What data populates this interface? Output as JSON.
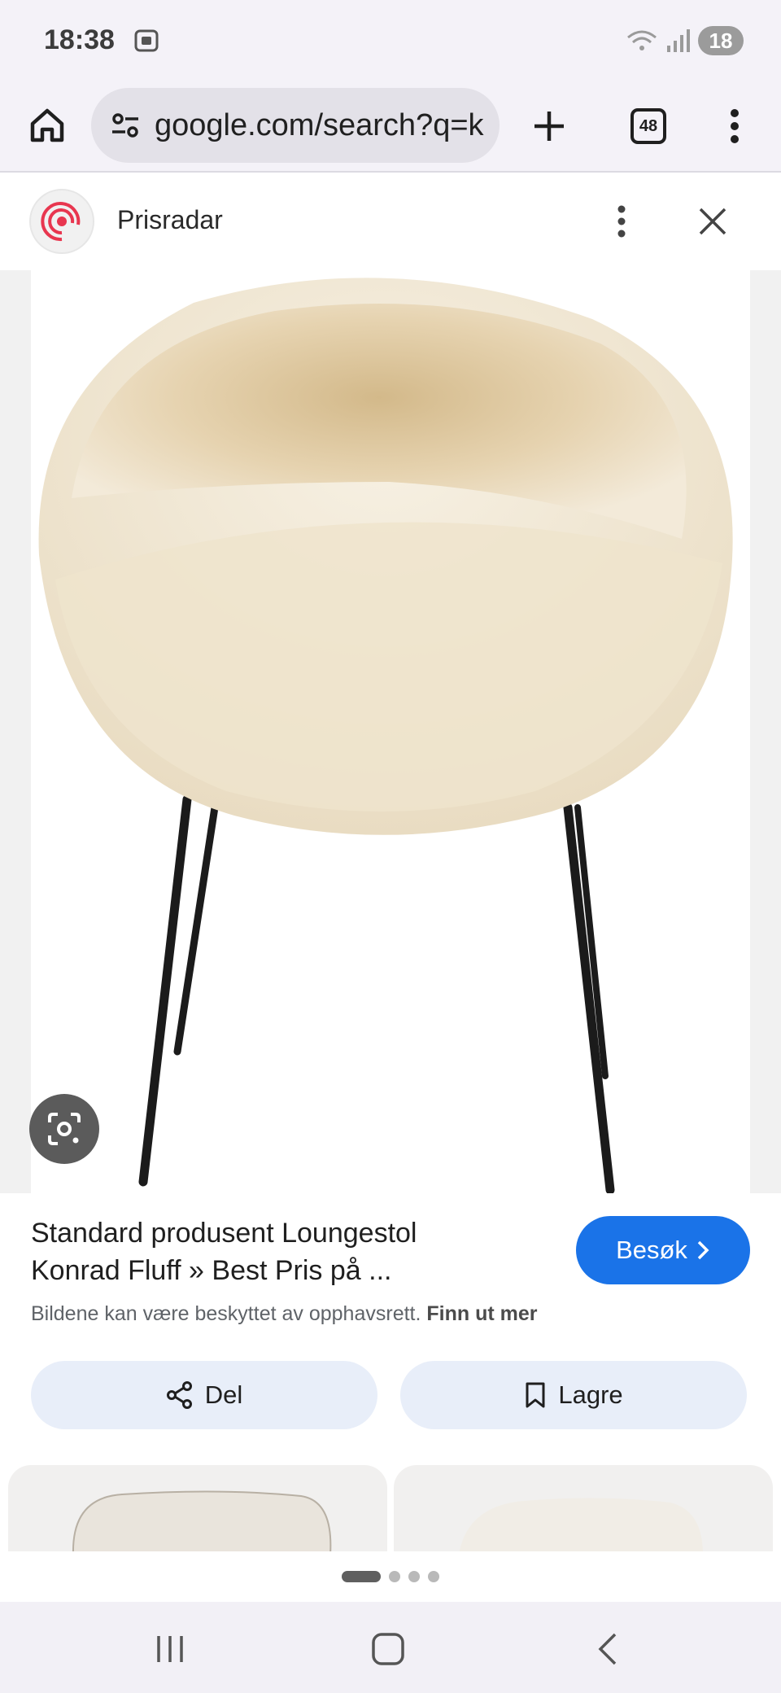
{
  "status_bar": {
    "time": "18:38",
    "battery": "18",
    "icons": [
      "screenshot-icon",
      "wifi-icon",
      "signal-icon",
      "battery-icon"
    ]
  },
  "browser": {
    "url": "google.com/search?q=k",
    "tab_count": "48",
    "icons": [
      "home-icon",
      "site-settings-icon",
      "plus-icon",
      "more-vert-icon"
    ]
  },
  "panel": {
    "app_name": "Prisradar",
    "icons": [
      "prisradar-logo",
      "more-vert-icon",
      "close-icon"
    ]
  },
  "result": {
    "title_line1": "Standard produsent Loungestol",
    "title_line2": "Konrad Fluff » Best Pris på ...",
    "visit_label": "Besøk",
    "copyright_text": "Bildene kan være beskyttet av opphavsrett.",
    "copyright_link": "Finn ut mer",
    "share_label": "Del",
    "save_label": "Lagre"
  },
  "pager": {
    "pages": 4,
    "active_index": 0
  },
  "colors": {
    "accent": "#1a73e8",
    "chip_bg": "#e8eef9",
    "toolbar_bg": "#f4f2f8",
    "logo_red": "#e8364f"
  }
}
